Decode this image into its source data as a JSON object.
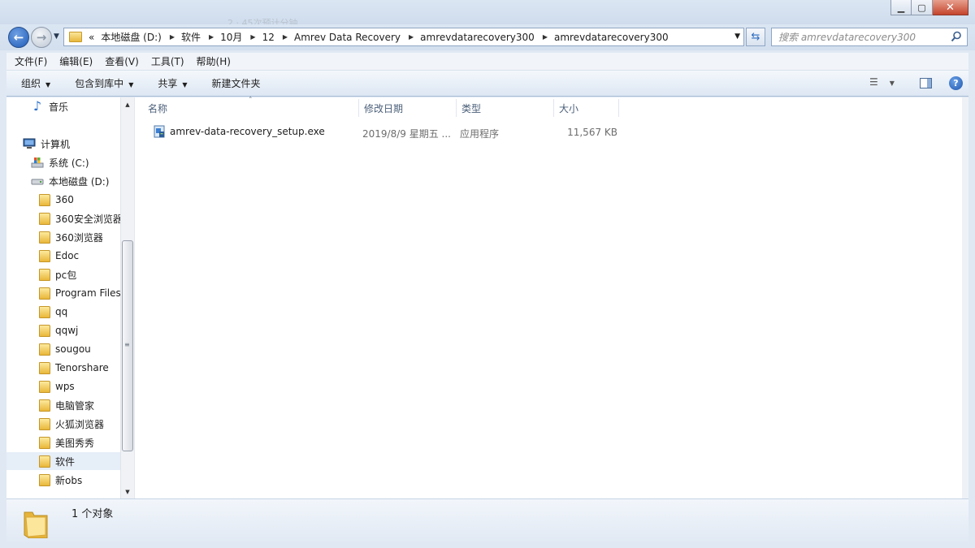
{
  "window": {
    "ghost_title": "2 · 45次预计分钟"
  },
  "nav": {
    "back_icon": "back-arrow-icon",
    "forward_icon": "forward-arrow-icon"
  },
  "address": {
    "overflow": "«",
    "segments": [
      "本地磁盘 (D:)",
      "软件",
      "10月",
      "12",
      "Amrev Data Recovery",
      "amrevdatarecovery300",
      "amrevdatarecovery300"
    ]
  },
  "search": {
    "placeholder": "搜索 amrevdatarecovery300"
  },
  "menubar": {
    "file": "文件(F)",
    "edit": "编辑(E)",
    "view": "查看(V)",
    "tools": "工具(T)",
    "help": "帮助(H)"
  },
  "toolbar": {
    "organize": "组织",
    "include_library": "包含到库中",
    "share": "共享",
    "new_folder": "新建文件夹"
  },
  "sidebar": {
    "music": "音乐",
    "computer": "计算机",
    "drive_c": "系统 (C:)",
    "drive_d": "本地磁盘 (D:)",
    "folders": [
      "360",
      "360安全浏览器",
      "360浏览器",
      "Edoc",
      "pc包",
      "Program Files",
      "qq",
      "qqwj",
      "sougou",
      "Tenorshare",
      "wps",
      "电脑管家",
      "火狐浏览器",
      "美图秀秀",
      "软件",
      "新obs"
    ],
    "selected": "软件"
  },
  "columns": {
    "name": "名称",
    "date": "修改日期",
    "type": "类型",
    "size": "大小"
  },
  "files": [
    {
      "name": "amrev-data-recovery_setup.exe",
      "date": "2019/8/9 星期五 ...",
      "type": "应用程序",
      "size": "11,567 KB"
    }
  ],
  "status": {
    "count": "1 个对象"
  },
  "colors": {
    "frame": "#dbe6f3",
    "accent": "#1f5cb8",
    "folder": "#e9b73a"
  }
}
